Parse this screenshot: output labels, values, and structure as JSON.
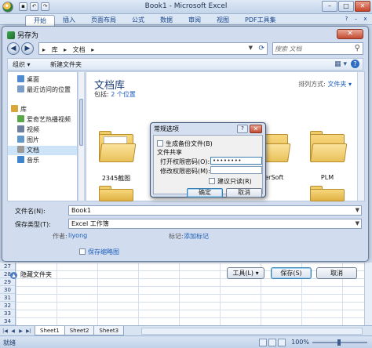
{
  "excel": {
    "title": "Book1 - Microsoft Excel",
    "tabs": [
      "开始",
      "插入",
      "页面布局",
      "公式",
      "数据",
      "审阅",
      "视图",
      "PDF工具集"
    ],
    "rows": [
      "27",
      "28",
      "29",
      "30",
      "31",
      "32",
      "33",
      "34"
    ],
    "sheets": [
      "Sheet1",
      "Sheet2",
      "Sheet3"
    ],
    "status": "就绪",
    "zoom": "100%"
  },
  "saveas": {
    "title": "另存为",
    "breadcrumb": [
      "库",
      "▸",
      "文档",
      "▸"
    ],
    "search_placeholder": "搜索 文档",
    "organize": "组织 ▾",
    "new_folder": "新建文件夹",
    "nav": [
      {
        "label": "桌面",
        "color": "#4f8bd1"
      },
      {
        "label": "最近访问的位置",
        "color": "#7a9cc6"
      },
      {
        "label": "库",
        "color": "#d8a63b"
      },
      {
        "label": "爱奇艺热播视频",
        "color": "#5aa84a"
      },
      {
        "label": "视频",
        "color": "#6f7fa0"
      },
      {
        "label": "图片",
        "color": "#5f98c9"
      },
      {
        "label": "文档",
        "color": "#9a9a9a"
      },
      {
        "label": "音乐",
        "color": "#3f84cc"
      }
    ],
    "library_title": "文档库",
    "library_includes_label": "包括:",
    "library_includes_value": "2 个位置",
    "arrange_label": "排列方式:",
    "arrange_value": "文件夹 ▾",
    "folders": [
      "2345截图",
      "werSoft",
      "PLM"
    ],
    "filename_label": "文件名(N):",
    "filename_value": "Book1",
    "type_label": "保存类型(T):",
    "type_value": "Excel 工作簿",
    "author_label": "作者:",
    "author_value": "liyong",
    "tag_label": "标记:",
    "tag_value": "添加标记",
    "thumbnail_label": "保存缩略图",
    "hide_folders": "隐藏文件夹",
    "tools_button": "工具(L) ▾",
    "save_button": "保存(S)",
    "cancel_button": "取消"
  },
  "general_options": {
    "title": "常规选项",
    "help": "?",
    "backup_label": "生成备份文件(B)",
    "sharing_label": "文件共享",
    "open_pw_label": "打开权限密码(O):",
    "open_pw_value": "••••••••",
    "modify_pw_label": "修改权限密码(M):",
    "modify_pw_value": "",
    "readonly_label": "建议只读(R)",
    "ok_button": "确定",
    "cancel_button": "取消"
  }
}
